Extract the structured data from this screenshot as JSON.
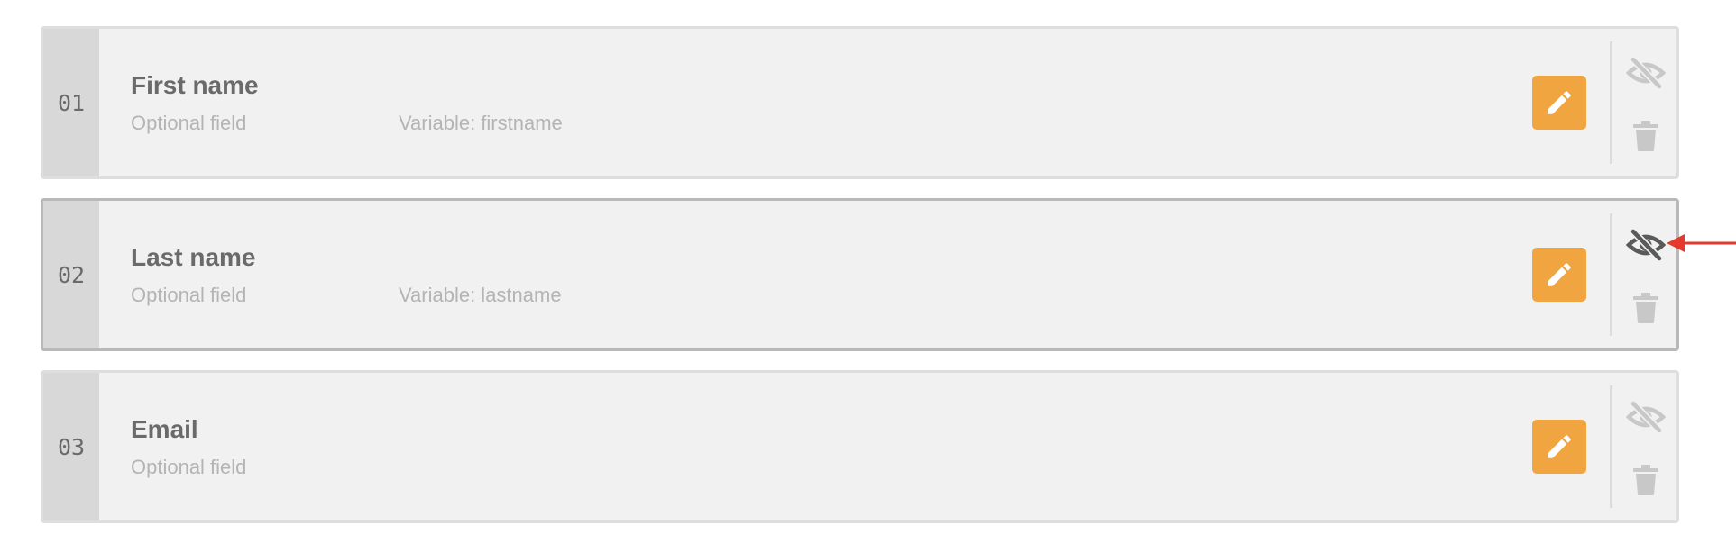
{
  "colors": {
    "row_background": "#f1f1f1",
    "index_background": "#d8d8d8",
    "edit_button": "#f0a540",
    "icon_inactive": "#c8c8c8",
    "icon_active": "#5a5a5a",
    "callout_arrow": "#e5392d"
  },
  "fields": [
    {
      "index": "01",
      "name": "First name",
      "optional_label": "Optional field",
      "variable_label": "Variable: firstname",
      "edit_icon": "pencil-icon",
      "visibility_icon": "eye-slash-icon",
      "delete_icon": "trash-icon"
    },
    {
      "index": "02",
      "name": "Last name",
      "optional_label": "Optional field",
      "variable_label": "Variable: lastname",
      "edit_icon": "pencil-icon",
      "visibility_icon": "eye-slash-icon",
      "delete_icon": "trash-icon"
    },
    {
      "index": "03",
      "name": "Email",
      "optional_label": "Optional field",
      "variable_label": "",
      "edit_icon": "pencil-icon",
      "visibility_icon": "eye-slash-icon",
      "delete_icon": "trash-icon"
    }
  ],
  "annotation": {
    "icon": "arrow-left-icon",
    "points_to": "fields.1.visibility_toggle"
  }
}
